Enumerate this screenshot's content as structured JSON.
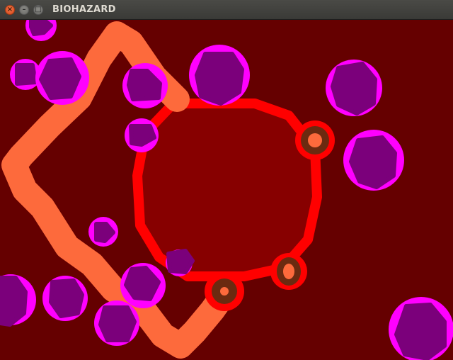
{
  "window": {
    "title": "BIOHAZARD",
    "close_glyph": "×",
    "minimize_glyph": "–",
    "maximize_glyph": "□"
  },
  "game": {
    "colors": {
      "background": "#650000",
      "arena_fill": "#870000",
      "arena_border": "#ff0000",
      "path": "#fd6a3c",
      "cell_glow": "#ff00ff",
      "cell_core": "#7b007b",
      "node_ring": "#6b2a10",
      "node_core": "#fd6a3c"
    },
    "cell_count": 15,
    "node_count": 3
  }
}
